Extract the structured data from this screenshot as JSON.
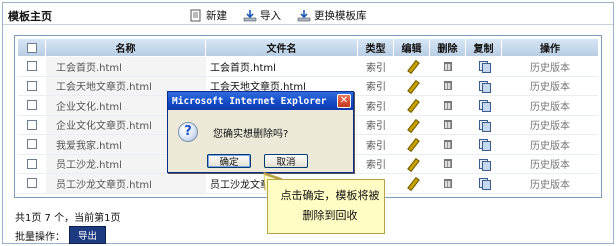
{
  "header": {
    "title": "模板主页",
    "actions": [
      {
        "label": "新建",
        "icon": "new-doc-icon"
      },
      {
        "label": "导入",
        "icon": "import-icon"
      },
      {
        "label": "更换模板库",
        "icon": "switch-library-icon"
      }
    ]
  },
  "table": {
    "columns": [
      "",
      "名称",
      "文件名",
      "类型",
      "编辑",
      "删除",
      "复制",
      "操作"
    ],
    "rows": [
      {
        "name": "工会首页.html",
        "file": "工会首页.html",
        "type": "索引",
        "history": "历史版本"
      },
      {
        "name": "工会天地文章页.html",
        "file": "工会天地文章页.html",
        "type": "索引",
        "history": "历史版本"
      },
      {
        "name": "企业文化.html",
        "file": "",
        "type": "索引",
        "history": "历史版本"
      },
      {
        "name": "企业文化文章页.html",
        "file": "",
        "type": "索引",
        "history": "历史版本"
      },
      {
        "name": "我爱我家.html",
        "file": "",
        "type": "索引",
        "history": "历史版本"
      },
      {
        "name": "员工沙龙.html",
        "file": "",
        "type": "索引",
        "history": "历史版本"
      },
      {
        "name": "员工沙龙文章页.html",
        "file": "员工沙龙文章页.html",
        "type": "索引",
        "history": "历史版本"
      }
    ]
  },
  "footer": {
    "page_info": "共1页  7 个，当前第1页",
    "batch_label": "批量操作：",
    "export_label": "导出"
  },
  "dialog": {
    "title": "Microsoft Internet Explorer",
    "message": "您确实想删除吗?",
    "ok_label": "确定",
    "cancel_label": "取消",
    "icon": "question-icon"
  },
  "callout": {
    "text": "点击确定，模板将被删除到回收"
  },
  "colors": {
    "header_gradient_top": "#d7e6f5",
    "dialog_title": "#1449c4",
    "export_button": "#1e3a80",
    "callout_bg": "#fffcc4"
  }
}
